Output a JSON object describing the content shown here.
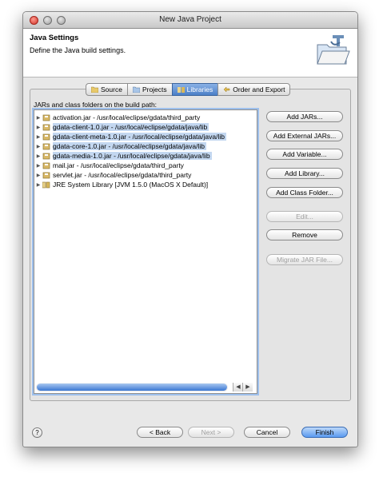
{
  "window": {
    "title": "New Java Project"
  },
  "header": {
    "title": "Java Settings",
    "description": "Define the Java build settings."
  },
  "tabs": [
    {
      "label": "Source",
      "icon": "source-folder-icon",
      "active": false
    },
    {
      "label": "Projects",
      "icon": "projects-icon",
      "active": false
    },
    {
      "label": "Libraries",
      "icon": "libraries-icon",
      "active": true
    },
    {
      "label": "Order and Export",
      "icon": "order-export-icon",
      "active": false
    }
  ],
  "libraries": {
    "label": "JARs and class folders on the build path:",
    "items": [
      {
        "text": "activation.jar - /usr/local/eclipse/gdata/third_party",
        "selected": false
      },
      {
        "text": "gdata-client-1.0.jar - /usr/local/eclipse/gdata/java/lib",
        "selected": true
      },
      {
        "text": "gdata-client-meta-1.0.jar - /usr/local/eclipse/gdata/java/lib",
        "selected": true
      },
      {
        "text": "gdata-core-1.0.jar - /usr/local/eclipse/gdata/java/lib",
        "selected": true
      },
      {
        "text": "gdata-media-1.0.jar - /usr/local/eclipse/gdata/java/lib",
        "selected": true
      },
      {
        "text": "mail.jar - /usr/local/eclipse/gdata/third_party",
        "selected": false
      },
      {
        "text": "servlet.jar - /usr/local/eclipse/gdata/third_party",
        "selected": false
      },
      {
        "text": "JRE System Library [JVM 1.5.0 (MacOS X Default)]",
        "selected": false
      }
    ]
  },
  "actions": {
    "add_jars": "Add JARs...",
    "add_external_jars": "Add External JARs...",
    "add_variable": "Add Variable...",
    "add_library": "Add Library...",
    "add_class_folder": "Add Class Folder...",
    "edit": "Edit...",
    "remove": "Remove",
    "migrate_jar": "Migrate JAR File..."
  },
  "footer": {
    "help": "?",
    "back": "< Back",
    "next": "Next >",
    "cancel": "Cancel",
    "finish": "Finish"
  },
  "colors": {
    "selection": "#c3d7f0",
    "accent": "#4c7fc7",
    "focus_ring": "#9ec0ec"
  }
}
